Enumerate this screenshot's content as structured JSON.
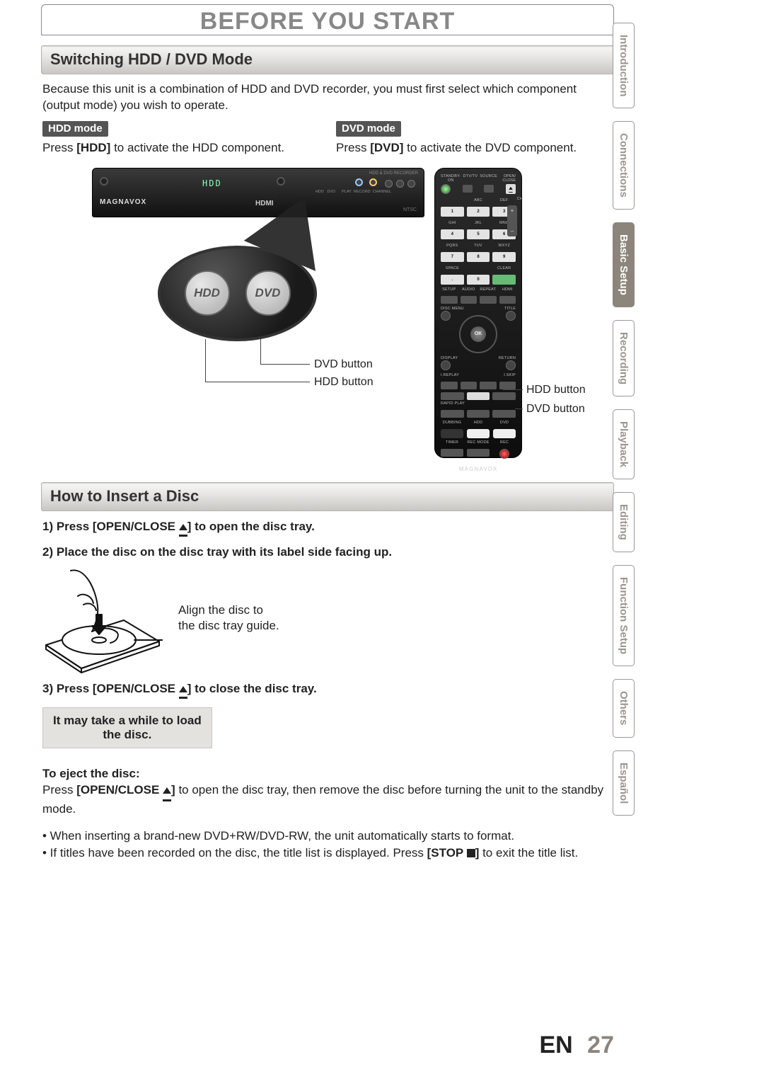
{
  "page_title": "BEFORE YOU START",
  "section1": {
    "heading": "Switching HDD / DVD Mode",
    "intro": "Because this unit is a combination of HDD and DVD recorder, you must first select which component (output mode) you wish to operate.",
    "hdd_chip": "HDD mode",
    "hdd_line_a": "Press ",
    "hdd_line_b": "[HDD]",
    "hdd_line_c": " to activate the HDD component.",
    "dvd_chip": "DVD mode",
    "dvd_line_a": "Press ",
    "dvd_line_b": "[DVD]",
    "dvd_line_c": " to activate the DVD component."
  },
  "illus": {
    "device_brand": "MAGNAVOX",
    "hdmi": "HDMI",
    "zoom_hdd": "HDD",
    "zoom_dvd": "DVD",
    "lbl_dvd_btn": "DVD button",
    "lbl_hdd_btn": "HDD button",
    "remote_brand": "MAGNAVOX",
    "remote_ok": "OK",
    "remote_open": "OPEN/\nCLOSE",
    "remote_row1": [
      "STANDBY-ON",
      "DTV/TV",
      "SOURCE"
    ],
    "remote_nums_top": [
      "1",
      "2",
      "3"
    ],
    "remote_nums_top_lbl": [
      "",
      "ABC",
      "DEF"
    ],
    "remote_nums_mid": [
      "4",
      "5",
      "6"
    ],
    "remote_nums_mid_lbl": [
      "GHI",
      "JKL",
      "MNO"
    ],
    "remote_nums_bot": [
      "7",
      "8",
      "9"
    ],
    "remote_nums_bot_lbl": [
      "PQRS",
      "TUV",
      "WXYZ"
    ],
    "remote_zero_row_lbl": [
      "SPACE",
      "",
      "CLEAR"
    ],
    "remote_zero_row": [
      ".",
      "0",
      ""
    ],
    "remote_row_setup": [
      "SETUP",
      "AUDIO",
      "REPEAT",
      "HDMI"
    ],
    "remote_side_l": "DISC MENU",
    "remote_side_r": "TITLE",
    "remote_display": "DISPLAY",
    "remote_return": "RETURN",
    "remote_replay": "I.REPLAY",
    "remote_skip": "I.SKIP",
    "remote_rapid": "RAPID PLAY",
    "remote_hd_row_lbl": [
      "DUBBING",
      "HDD",
      "DVD"
    ],
    "remote_hd_row": [
      "",
      "",
      ""
    ],
    "remote_bot_row_lbl": [
      "TIMER",
      "REC MODE",
      "REC"
    ],
    "remote_ch": "CH",
    "remote_vol": ""
  },
  "section2": {
    "heading": "How to Insert a Disc",
    "step1_a": "1) Press [OPEN/CLOSE ",
    "step1_b": "] to open the disc tray.",
    "step2": "2) Place the disc on the disc tray with its label side facing up.",
    "align1": "Align the disc to",
    "align2": "the disc tray guide.",
    "step3_a": "3) Press [OPEN/CLOSE ",
    "step3_b": "] to close the disc tray.",
    "notice_l1": "It may take a while to load",
    "notice_l2": "the disc.",
    "eject_head": "To eject the disc:",
    "eject_a": "Press ",
    "eject_b": "[OPEN/CLOSE ",
    "eject_c": "]",
    "eject_d": " to open the disc tray, then remove the disc before turning the unit to the standby mode.",
    "bullet1": "• When inserting a brand-new DVD+RW/DVD-RW, the unit automatically starts to format.",
    "bullet2_a": "• If titles have been recorded on the disc, the title list is displayed. Press ",
    "bullet2_b": "[STOP ",
    "bullet2_c": "]",
    "bullet2_d": " to exit the title list."
  },
  "tabs": [
    "Introduction",
    "Connections",
    "Basic Setup",
    "Recording",
    "Playback",
    "Editing",
    "Function Setup",
    "Others",
    "Español"
  ],
  "active_tab_index": 2,
  "footer": {
    "lang": "EN",
    "page": "27"
  }
}
